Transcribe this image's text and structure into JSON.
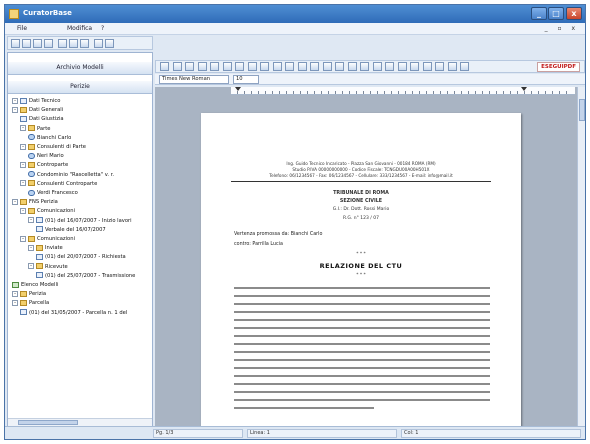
{
  "window": {
    "title": "CuratorBase",
    "buttons": {
      "minimize": "_",
      "maximize": "□",
      "close": "x"
    }
  },
  "menubar": {
    "items": [
      "File",
      "Modifica",
      "?"
    ],
    "mdi_controls": "_ ▫ x"
  },
  "left_panel": {
    "archive_header": "Archivio Modelli",
    "perizie_header": "Perizie",
    "tree": [
      {
        "indent": 0,
        "expander": "-",
        "icon": "doc",
        "label": "Dati Tecnico"
      },
      {
        "indent": 0,
        "expander": "-",
        "icon": "folder",
        "label": "Dati Generali"
      },
      {
        "indent": 1,
        "expander": "",
        "icon": "doc",
        "label": "Dati Giustizia"
      },
      {
        "indent": 1,
        "expander": "-",
        "icon": "folder",
        "label": "Parte"
      },
      {
        "indent": 2,
        "expander": "",
        "icon": "person",
        "label": "Bianchi Carlo"
      },
      {
        "indent": 1,
        "expander": "-",
        "icon": "folder",
        "label": "Consulenti di Parte"
      },
      {
        "indent": 2,
        "expander": "",
        "icon": "person",
        "label": "Neri Mario"
      },
      {
        "indent": 1,
        "expander": "-",
        "icon": "folder",
        "label": "Controparte"
      },
      {
        "indent": 2,
        "expander": "",
        "icon": "person",
        "label": "Condominio \"Rascelletta\" v. r."
      },
      {
        "indent": 1,
        "expander": "-",
        "icon": "folder",
        "label": "Consulenti Controparte"
      },
      {
        "indent": 2,
        "expander": "",
        "icon": "person",
        "label": "Verdi Francesco"
      },
      {
        "indent": 0,
        "expander": "-",
        "icon": "folder",
        "label": "FNS Perizia"
      },
      {
        "indent": 1,
        "expander": "-",
        "icon": "folder",
        "label": "Comunicazioni"
      },
      {
        "indent": 2,
        "expander": "-",
        "icon": "doc",
        "label": "(01) del 16/07/2007 - Inizio lavori"
      },
      {
        "indent": 3,
        "expander": "",
        "icon": "doc",
        "label": "Verbale del 16/07/2007"
      },
      {
        "indent": 1,
        "expander": "-",
        "icon": "folder",
        "label": "Comunicazioni"
      },
      {
        "indent": 2,
        "expander": "-",
        "icon": "folder",
        "label": "Inviate"
      },
      {
        "indent": 3,
        "expander": "",
        "icon": "doc",
        "label": "(01) del 20/07/2007 - Richiesta"
      },
      {
        "indent": 2,
        "expander": "-",
        "icon": "folder",
        "label": "Ricevute"
      },
      {
        "indent": 3,
        "expander": "",
        "icon": "doc",
        "label": "(01) del 25/07/2007 - Trasmissione"
      },
      {
        "indent": 0,
        "expander": "",
        "icon": "check",
        "label": "Elenco Modelli"
      },
      {
        "indent": 0,
        "expander": "-",
        "icon": "folder",
        "label": "Perizia"
      },
      {
        "indent": 0,
        "expander": "-",
        "icon": "folder",
        "label": "Parcella"
      },
      {
        "indent": 1,
        "expander": "",
        "icon": "doc",
        "label": "(01) del 31/05/2007 - Parcella n. 1 del"
      }
    ]
  },
  "doc_toolbar": {
    "pdf_button": "ESEGUIPDF",
    "font_name": "Times New Roman",
    "font_size": "10"
  },
  "document": {
    "header_line1": "Ing. Guido Tecnico Incaricato - Piazza San Giovanni - 00184 ROMA (RM)",
    "header_line2": "Studio P.IVA 00000000000 - Codice Fiscale: TCNGDU00A00H501X",
    "header_line3": "Telefono: 06/1234567 - Fax: 06/1234567 - Cellulare: 333/1234567 - E-mail: info@mail.it",
    "tribunale": "TRIBUNALE DI ROMA",
    "sezione": "SEZIONE CIVILE",
    "giudice": "G.I.: Dr. Dott. Rossi Mario",
    "rg": "R.G. n° 123 / 07",
    "parti": "Vertenza promossa da: Bianchi Carlo",
    "contro": "contro: Parrilla Lucia",
    "stars": "* * *",
    "relazione_title": "RELAZIONE DEL CTU"
  },
  "statusbar": {
    "page": "Pg. 1/3",
    "line": "Linea: 1",
    "col": "Col: 1"
  }
}
